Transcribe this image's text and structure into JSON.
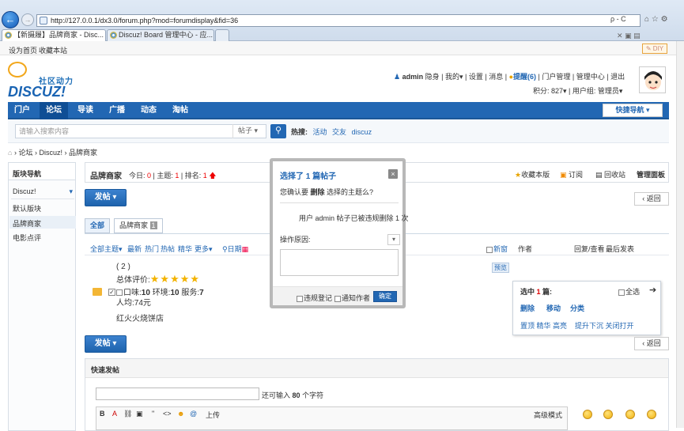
{
  "browser": {
    "address": "http://127.0.0.1/dx3.0/forum.php?mod=forumdisplay&fid=36",
    "addr_tools": "ρ - C",
    "tabs": [
      "【新摄履】品牌商家 - Disc...",
      "Discuz! Board 管理中心 - 应..."
    ],
    "tab_close": "×"
  },
  "toolbar": {
    "set_home": "设为首页",
    "bookmark": "收藏本站",
    "diy": "DIY"
  },
  "logo": {
    "cn": "社区动力",
    "en": "DISCUZ!"
  },
  "user": {
    "name": "admin",
    "stealth": "隐身",
    "mine": "我的",
    "settings": "设置",
    "messages": "消息",
    "remind": "提醒(6)",
    "portal_admin": "门户管理",
    "admin_center": "管理中心",
    "logout": "退出",
    "points": "积分: 827",
    "group": "用户组: 管理员"
  },
  "nav": {
    "items": [
      "门户",
      "论坛",
      "导读",
      "广播",
      "动态",
      "淘帖"
    ],
    "quick_nav": "快捷导航"
  },
  "search": {
    "placeholder": "请输入搜索内容",
    "type": "帖子",
    "hot_label": "热搜:",
    "hot_items": [
      "活动",
      "交友",
      "discuz"
    ]
  },
  "breadcrumb": {
    "home_sep": "›",
    "items": [
      "论坛",
      "Discuz!",
      "品牌商家"
    ]
  },
  "sidebar": {
    "title": "版块导航",
    "group": "Discuz!",
    "items": [
      "默认版块",
      "品牌商家",
      "电影点评"
    ]
  },
  "forum": {
    "name": "品牌商家",
    "today": "今日: ",
    "today_val": "0",
    "topics": "主题: ",
    "topics_val": "1",
    "rank": "排名: ",
    "rank_val": "1",
    "fav": "收藏本版",
    "subscribe": "订阅",
    "recycle": "回收站",
    "manage": "管理面板",
    "post_btn": "发帖",
    "back_btn": "返回"
  },
  "filters": {
    "all": "全部",
    "tag": "品牌商家",
    "tag_count": "1"
  },
  "threadbar": {
    "all_topics": "全部主题",
    "items": [
      "最新",
      "热门",
      "热帖",
      "精华",
      "更多"
    ],
    "date": "日期",
    "new_window": "新窗",
    "author": "作者",
    "replies": "回复/查看",
    "last_post": "最后发表"
  },
  "thread": {
    "count": "( 2 )",
    "overall": "总体评价:",
    "stars": 5,
    "taste": "口味:",
    "taste_val": "10",
    "env": "环境:",
    "env_val": "10",
    "service": "服务:",
    "service_val": "7",
    "avg": "人均:74元",
    "title": "红火火烧饼店",
    "preview": "预览"
  },
  "modal": {
    "title": "选择了 1 篇帖子",
    "confirm": "您确认要 删除 选择的主题么?",
    "confirm_bold": "删除",
    "note": "用户 admin 帖子已被违规删除 1 次",
    "reason_label": "操作原因:",
    "violation": "违规登记",
    "notify": "通知作者",
    "ok": "确定",
    "close": "×"
  },
  "modpanel": {
    "selected": "选中 1 篇:",
    "select_all": "全选",
    "delete": "删除",
    "move": "移动",
    "classify": "分类",
    "row2": "置顶 精华 高亮",
    "row2b": "提升下沉 关闭打开"
  },
  "quickpost": {
    "title": "快速发帖",
    "limit_pre": "还可输入",
    "limit_num": "80",
    "limit_suf": "个字符",
    "upload": "上传",
    "advanced": "高级模式"
  },
  "colors": {
    "brand": "#2267b3",
    "accent": "#e00000"
  }
}
